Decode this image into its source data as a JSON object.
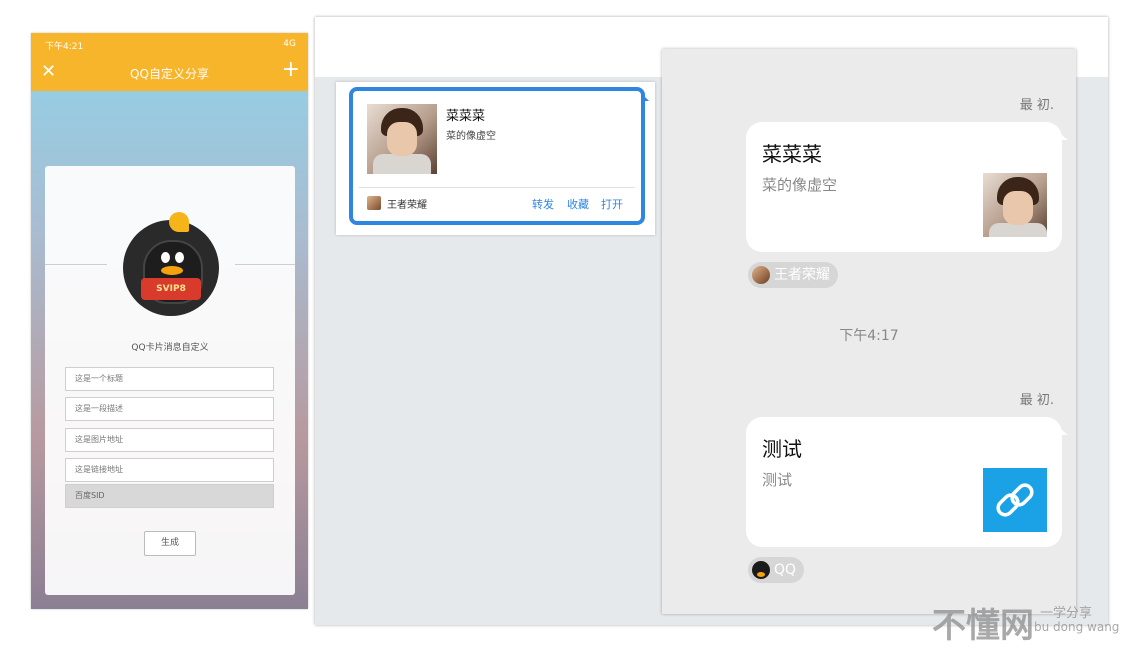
{
  "phone": {
    "status_time": "下午4:21",
    "status_signal": "4G",
    "title": "QQ自定义分享",
    "close_icon": "close-icon",
    "add_icon": "plus-icon",
    "subtitle": "QQ卡片消息自定义",
    "logo_text": "SVIP8",
    "placeholders": {
      "title": "这是一个标题",
      "desc": "这是一段描述",
      "image": "这是图片地址",
      "link": "这是链接地址"
    },
    "baidu_sid": "百度SID",
    "generate_label": "生成"
  },
  "card_preview": {
    "title": "菜菜菜",
    "desc": "菜的像虚空",
    "source": "王者荣耀",
    "actions": [
      "转发",
      "收藏",
      "打开"
    ]
  },
  "chat": {
    "sender_name": "最 初.",
    "msg1": {
      "title": "菜菜菜",
      "desc": "菜的像虚空",
      "source": "王者荣耀"
    },
    "timestamp": "下午4:17",
    "msg2": {
      "title": "测试",
      "desc": "测试",
      "source": "QQ"
    },
    "link_icon": "link-icon"
  },
  "watermark": {
    "main": "不懂网",
    "tag": "一学分享",
    "pinyin": "bu dong wang"
  },
  "colors": {
    "accent_orange": "#f7b52c",
    "accent_blue": "#2e86e0",
    "link_tile": "#1ba2e6"
  }
}
